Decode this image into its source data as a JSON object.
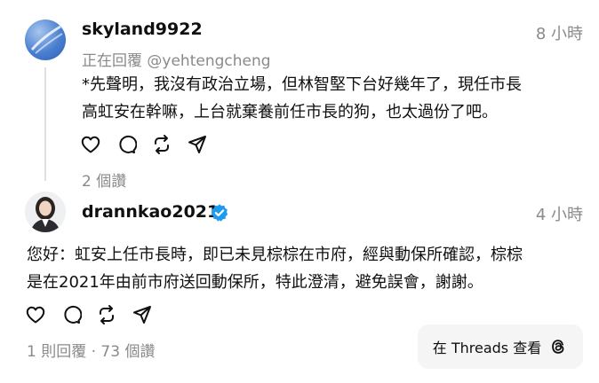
{
  "post1": {
    "username": "skyland9922",
    "time": "8 小時",
    "replying_to": "正在回覆 @yehtengcheng",
    "body_line1": "*先聲明，我沒有政治立場，但林智堅下台好幾年了，現任市長",
    "body_line2": "高虹安在幹嘛，上台就棄養前任市長的狗，也太過份了吧。",
    "likes": "2 個讚"
  },
  "post2": {
    "username": "drannkao2021",
    "time": "4 小時",
    "body_line1": "您好：虹安上任市長時，即已未見棕棕在市府，經與動保所確認，棕棕",
    "body_line2": "是在2021年由前市府送回動保所，特此澄清，避免誤會，謝謝。",
    "meta": "1 則回覆 · 73 個讚"
  },
  "threads_button": {
    "label": "在 Threads 查看"
  },
  "icons": [
    "heart-icon",
    "comment-icon",
    "repost-icon",
    "share-icon",
    "verified-badge-icon",
    "threads-logo-icon"
  ],
  "colors": {
    "verified": "#1d9bf0",
    "muted": "#8a8a8a",
    "button_bg": "#f5f5f5"
  }
}
